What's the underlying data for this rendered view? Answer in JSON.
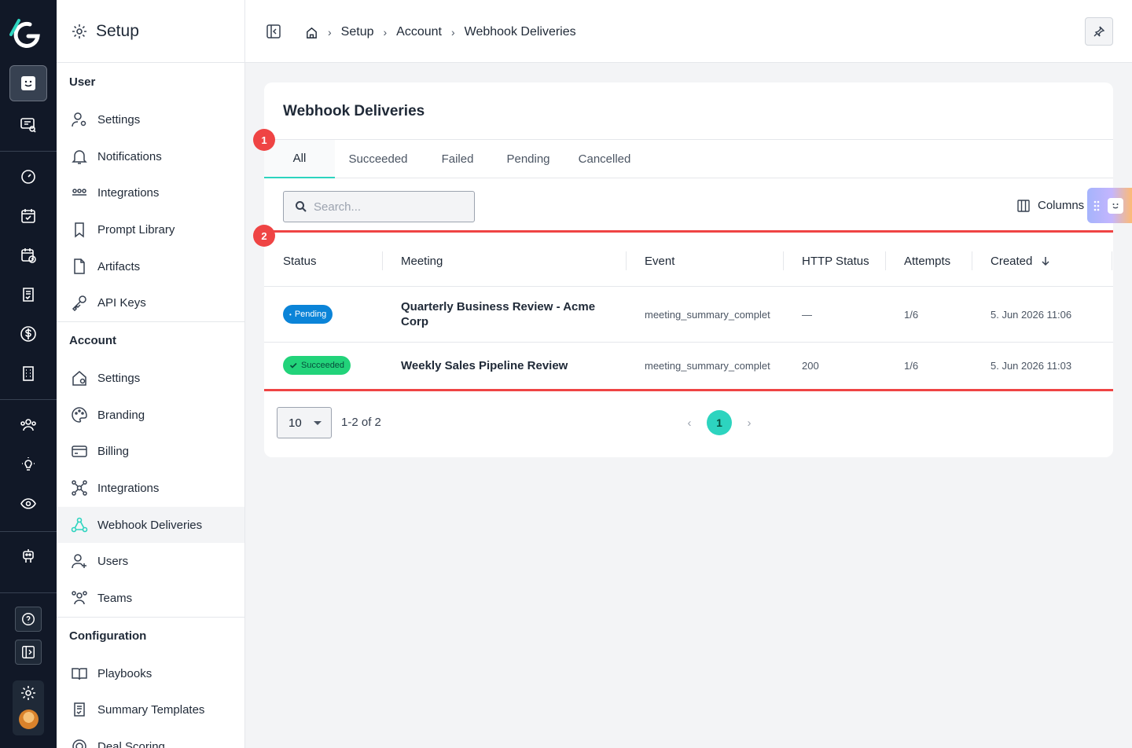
{
  "sidebar": {
    "title": "Setup",
    "sections": [
      {
        "label": "User",
        "items": [
          "Settings",
          "Notifications",
          "Integrations",
          "Prompt Library",
          "Artifacts",
          "API Keys"
        ]
      },
      {
        "label": "Account",
        "items": [
          "Settings",
          "Branding",
          "Billing",
          "Integrations",
          "Webhook Deliveries",
          "Users",
          "Teams"
        ]
      },
      {
        "label": "Configuration",
        "items": [
          "Playbooks",
          "Summary Templates",
          "Deal Scoring"
        ]
      }
    ],
    "active_item": "Webhook Deliveries"
  },
  "breadcrumb": {
    "items": [
      "Setup",
      "Account",
      "Webhook Deliveries"
    ]
  },
  "page": {
    "title": "Webhook Deliveries",
    "tabs": [
      "All",
      "Succeeded",
      "Failed",
      "Pending",
      "Cancelled"
    ],
    "active_tab": "All",
    "search_placeholder": "Search...",
    "columns_label": "Columns",
    "markers": [
      "1",
      "2"
    ]
  },
  "table": {
    "headers": [
      "Status",
      "Meeting",
      "Event",
      "HTTP Status",
      "Attempts",
      "Created"
    ],
    "sort": {
      "column": "Created",
      "direction": "desc"
    },
    "rows": [
      {
        "status": "Pending",
        "meeting": "Quarterly Business Review - Acme Corp",
        "event": "meeting_summary_complet",
        "http_status": "—",
        "attempts": "1/6",
        "created": "5. Jun 2026 11:06"
      },
      {
        "status": "Succeeded",
        "meeting": "Weekly Sales Pipeline Review",
        "event": "meeting_summary_complet",
        "http_status": "200",
        "attempts": "1/6",
        "created": "5. Jun 2026 11:03"
      }
    ]
  },
  "pagination": {
    "page_size": "10",
    "range": "1-2 of 2",
    "current_page": "1"
  },
  "colors": {
    "accent": "#2dd4bf",
    "rail": "#111827",
    "marker": "#ef4444",
    "pending": "#0b84d8",
    "succeeded": "#22d37a"
  }
}
